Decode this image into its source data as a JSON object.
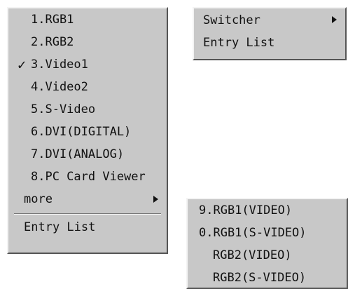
{
  "main_menu": {
    "items": [
      {
        "label": "1.RGB1",
        "checked": false
      },
      {
        "label": "2.RGB2",
        "checked": false
      },
      {
        "label": "3.Video1",
        "checked": true
      },
      {
        "label": "4.Video2",
        "checked": false
      },
      {
        "label": "5.S-Video",
        "checked": false
      },
      {
        "label": "6.DVI(DIGITAL)",
        "checked": false
      },
      {
        "label": "7.DVI(ANALOG)",
        "checked": false
      },
      {
        "label": "8.PC Card Viewer",
        "checked": false
      }
    ],
    "more_label": "more",
    "entry_list_label": "Entry List",
    "check_glyph": "✓"
  },
  "top_menu": {
    "switcher_label": "Switcher",
    "entry_list_label": "Entry List"
  },
  "sub_menu": {
    "items": [
      {
        "label": "9.RGB1(VIDEO)"
      },
      {
        "label": "0.RGB1(S-VIDEO)"
      },
      {
        "label": "RGB2(VIDEO)"
      },
      {
        "label": "RGB2(S-VIDEO)"
      }
    ]
  },
  "colors": {
    "menu_background": "#c8c8c8",
    "text": "#111111"
  }
}
